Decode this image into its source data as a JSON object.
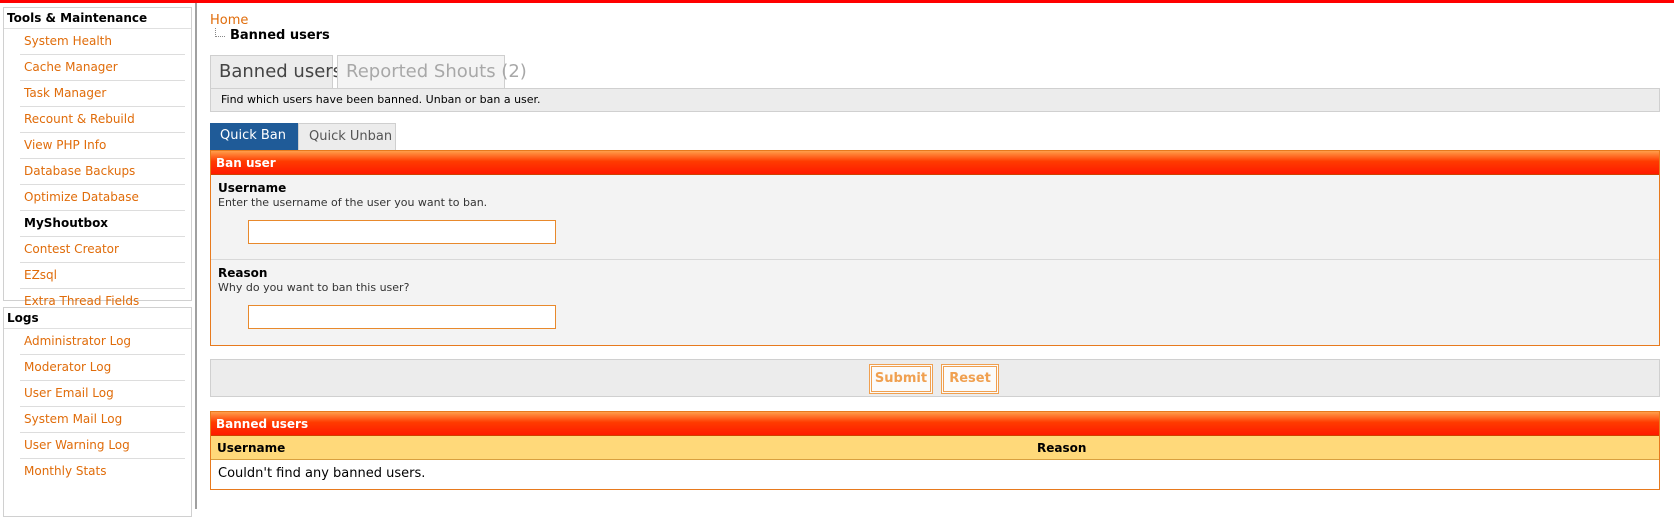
{
  "colors": {
    "accent_orange": "#e06c0a",
    "top_bar_red": "#ff0000",
    "active_tab_blue": "#1f5b98",
    "table_header_yellow": "#ffd97a"
  },
  "sidebar": {
    "sections": [
      {
        "title": "Tools & Maintenance",
        "items": [
          {
            "label": "System Health"
          },
          {
            "label": "Cache Manager"
          },
          {
            "label": "Task Manager"
          },
          {
            "label": "Recount & Rebuild"
          },
          {
            "label": "View PHP Info"
          },
          {
            "label": "Database Backups"
          },
          {
            "label": "Optimize Database"
          },
          {
            "label": "MyShoutbox"
          },
          {
            "label": "Contest Creator"
          },
          {
            "label": "EZsql"
          },
          {
            "label": "Extra Thread Fields"
          }
        ]
      },
      {
        "title": "Logs",
        "items": [
          {
            "label": "Administrator Log"
          },
          {
            "label": "Moderator Log"
          },
          {
            "label": "User Email Log"
          },
          {
            "label": "System Mail Log"
          },
          {
            "label": "User Warning Log"
          },
          {
            "label": "Monthly Stats"
          }
        ]
      }
    ]
  },
  "breadcrumb": {
    "home": "Home",
    "current": "Banned users"
  },
  "page_tabs": [
    {
      "label": "Banned users",
      "active": true
    },
    {
      "label": "Reported Shouts (2)",
      "active": false
    }
  ],
  "description": "Find which users have been banned. Unban or ban a user.",
  "sub_tabs": [
    {
      "label": "Quick Ban",
      "active": true
    },
    {
      "label": "Quick Unban",
      "active": false
    }
  ],
  "ban_form": {
    "title": "Ban user",
    "fields": [
      {
        "label": "Username",
        "description": "Enter the username of the user you want to ban.",
        "value": ""
      },
      {
        "label": "Reason",
        "description": "Why do you want to ban this user?",
        "value": ""
      }
    ],
    "submit_label": "Submit",
    "reset_label": "Reset"
  },
  "banned_table": {
    "title": "Banned users",
    "columns": [
      "Username",
      "Reason"
    ],
    "empty_message": "Couldn't find any banned users."
  }
}
